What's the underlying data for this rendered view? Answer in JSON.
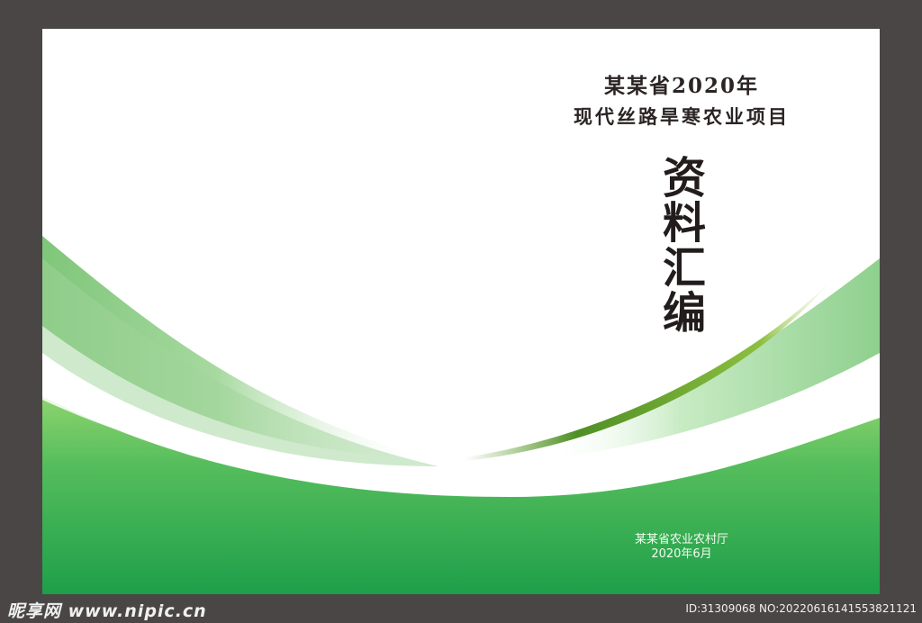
{
  "cover": {
    "title_line_1": "某某省2020年",
    "title_line_2": "现代丝路旱寒农业项目",
    "main_title": "资料汇编",
    "publisher": "某某省农业农村厅",
    "date": "2020年6月"
  },
  "watermark": {
    "logo_text": "昵享网 www.nipic.cn",
    "id_text": "ID:31309068 NO:20220616141553821121"
  },
  "colors": {
    "frame": "#4a4646",
    "page": "#ffffff",
    "green_light": "#8cd080",
    "green_mid": "#4cb85a",
    "green_dark": "#20a04a"
  }
}
